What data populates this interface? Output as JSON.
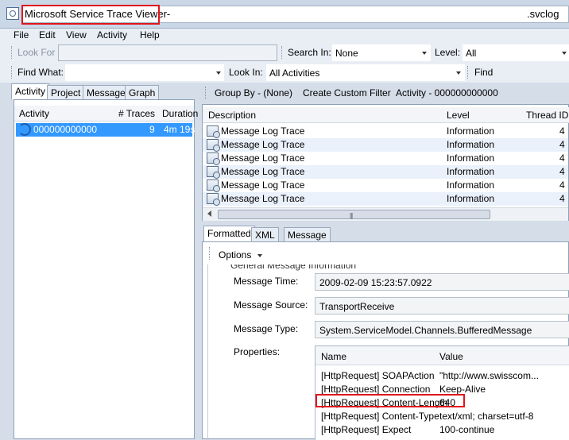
{
  "window": {
    "title": "Microsoft Service Trace Viewer-",
    "title_suffix": ".svclog"
  },
  "menu": [
    "File",
    "Edit",
    "View",
    "Activity",
    "Help"
  ],
  "toolbar1": {
    "look_for_label": "Look For",
    "search_in_label": "Search In:",
    "search_in_value": "None",
    "level_label": "Level:",
    "level_value": "All"
  },
  "toolbar2": {
    "find_what_label": "Find What:",
    "look_in_label": "Look In:",
    "look_in_value": "All Activities",
    "find_label": "Find"
  },
  "left_tabs": [
    "Activity",
    "Project",
    "Message",
    "Graph"
  ],
  "activity_table": {
    "headers": [
      "Activity",
      "# Traces",
      "Duration"
    ],
    "rows": [
      {
        "activity": "000000000000",
        "traces": "9",
        "duration": "4m 19s"
      }
    ]
  },
  "right_toolbar": {
    "group_by": "Group By - (None)",
    "custom_filter": "Create Custom Filter",
    "activity": "Activity - 000000000000"
  },
  "trace_table": {
    "headers": [
      "Description",
      "Level",
      "Thread ID"
    ],
    "rows": [
      {
        "description": "Message Log Trace",
        "level": "Information",
        "thread": "4"
      },
      {
        "description": "Message Log Trace",
        "level": "Information",
        "thread": "4"
      },
      {
        "description": "Message Log Trace",
        "level": "Information",
        "thread": "4"
      },
      {
        "description": "Message Log Trace",
        "level": "Information",
        "thread": "4"
      },
      {
        "description": "Message Log Trace",
        "level": "Information",
        "thread": "4"
      },
      {
        "description": "Message Log Trace",
        "level": "Information",
        "thread": "4"
      }
    ]
  },
  "detail_tabs": [
    "Formatted",
    "XML",
    "Message"
  ],
  "options_label": "Options",
  "details": {
    "section_header": "General Message Information",
    "message_time_label": "Message Time:",
    "message_time_value": "2009-02-09 15:23:57.0922",
    "message_source_label": "Message Source:",
    "message_source_value": "TransportReceive",
    "message_type_label": "Message Type:",
    "message_type_value": "System.ServiceModel.Channels.BufferedMessage",
    "properties_label": "Properties:",
    "properties_headers": [
      "Name",
      "Value"
    ],
    "properties": [
      {
        "name": "[HttpRequest] SOAPAction",
        "value": "\"http://www.swisscom..."
      },
      {
        "name": "[HttpRequest] Connection",
        "value": "Keep-Alive"
      },
      {
        "name": "[HttpRequest] Content-Length",
        "value": "640"
      },
      {
        "name": "[HttpRequest] Content-Type",
        "value": "text/xml; charset=utf-8"
      },
      {
        "name": "[HttpRequest] Expect",
        "value": "100-continue"
      }
    ]
  },
  "colors": {
    "selection": "#3399ff",
    "highlight_box": "#e0151d",
    "alt_row": "#eaf1fb"
  }
}
